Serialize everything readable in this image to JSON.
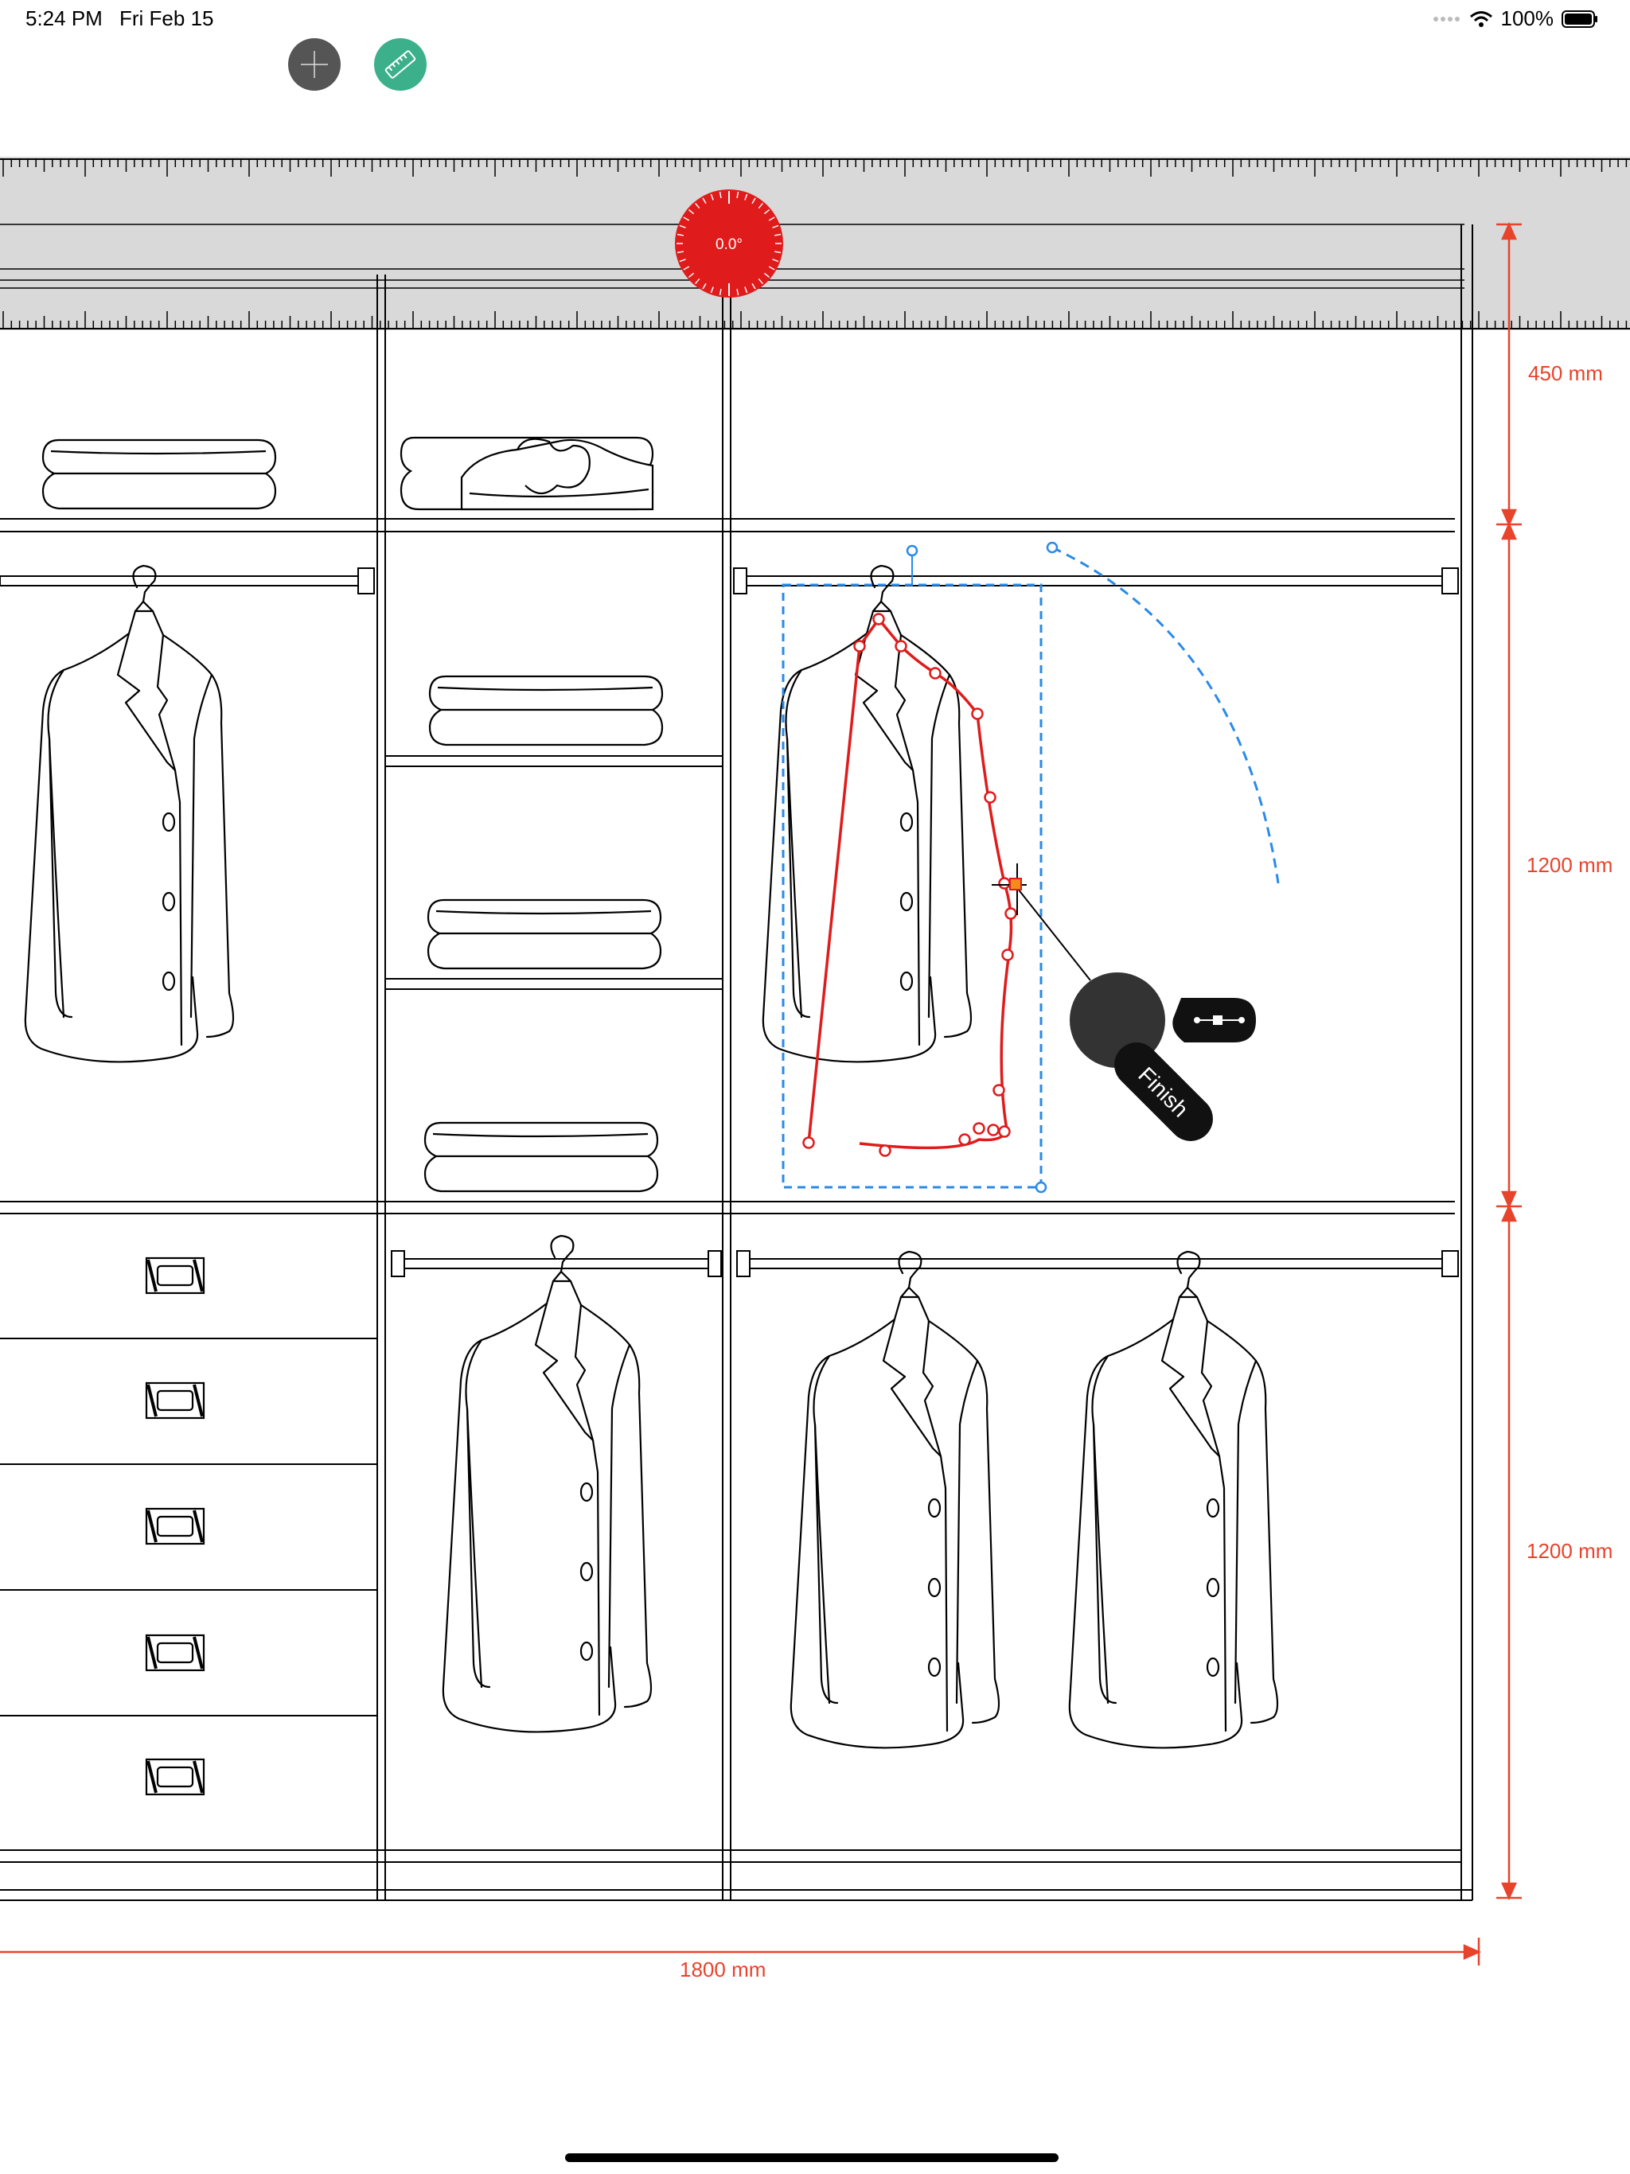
{
  "status_bar": {
    "time": "5:24 PM",
    "date": "Fri Feb 15",
    "battery": "100%",
    "icons": [
      "cellular-dots-icon",
      "wifi-icon",
      "battery-icon"
    ]
  },
  "toolbar": {
    "buttons": [
      {
        "name": "crosshair-tool-button",
        "icon": "crosshair-icon",
        "color": "#555555"
      },
      {
        "name": "ruler-tool-button",
        "icon": "ruler-icon",
        "color": "#3bb08a"
      }
    ]
  },
  "ruler": {
    "angle_label": "0.0°",
    "dial_color": "#e01b1b"
  },
  "dimensions": {
    "top_shelf": "450 mm",
    "middle_section": "1200 mm",
    "bottom_section": "1200 mm",
    "total_width": "1800 mm",
    "color": "#e8432b"
  },
  "selection": {
    "stroke_color": "#e01b1b",
    "box_color": "#2a8ae8"
  },
  "pencil_menu": {
    "finish_label": "Finish",
    "options": [
      "path-edit-icon"
    ]
  }
}
